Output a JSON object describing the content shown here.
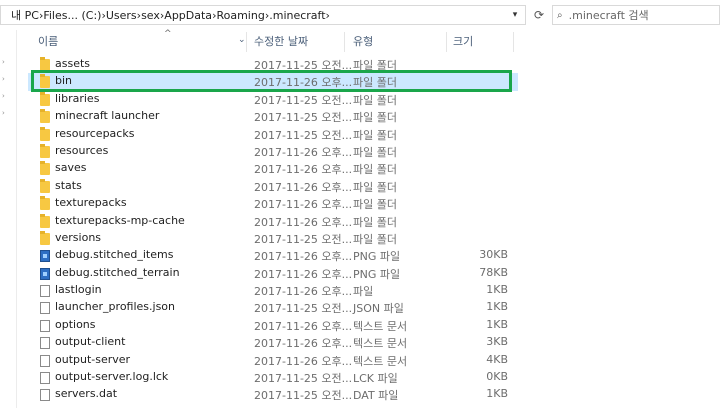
{
  "address": {
    "crumbs": [
      "내 PC",
      "Files... (C:)",
      "Users",
      "sex",
      "AppData",
      "Roaming",
      ".minecraft"
    ]
  },
  "search": {
    "placeholder": ".minecraft 검색"
  },
  "columns": {
    "name": "이름",
    "date": "수정한 날짜",
    "type": "유형",
    "size": "크기"
  },
  "files": [
    {
      "name": "assets",
      "date": "2017-11-25 오전...",
      "type": "파일 폴더",
      "size": "",
      "icon": "folder-icon"
    },
    {
      "name": "bin",
      "date": "2017-11-26 오후...",
      "type": "파일 폴더",
      "size": "",
      "icon": "folder-icon"
    },
    {
      "name": "libraries",
      "date": "2017-11-25 오전...",
      "type": "파일 폴더",
      "size": "",
      "icon": "folder-icon"
    },
    {
      "name": "minecraft launcher",
      "date": "2017-11-25 오전...",
      "type": "파일 폴더",
      "size": "",
      "icon": "folder-icon"
    },
    {
      "name": "resourcepacks",
      "date": "2017-11-25 오전...",
      "type": "파일 폴더",
      "size": "",
      "icon": "folder-icon"
    },
    {
      "name": "resources",
      "date": "2017-11-26 오후...",
      "type": "파일 폴더",
      "size": "",
      "icon": "folder-icon"
    },
    {
      "name": "saves",
      "date": "2017-11-26 오후...",
      "type": "파일 폴더",
      "size": "",
      "icon": "folder-icon"
    },
    {
      "name": "stats",
      "date": "2017-11-26 오후...",
      "type": "파일 폴더",
      "size": "",
      "icon": "folder-icon"
    },
    {
      "name": "texturepacks",
      "date": "2017-11-26 오후...",
      "type": "파일 폴더",
      "size": "",
      "icon": "folder-icon"
    },
    {
      "name": "texturepacks-mp-cache",
      "date": "2017-11-26 오후...",
      "type": "파일 폴더",
      "size": "",
      "icon": "folder-icon"
    },
    {
      "name": "versions",
      "date": "2017-11-25 오전...",
      "type": "파일 폴더",
      "size": "",
      "icon": "folder-icon"
    },
    {
      "name": "debug.stitched_items",
      "date": "2017-11-26 오후...",
      "type": "PNG 파일",
      "size": "30KB",
      "icon": "image-file-icon"
    },
    {
      "name": "debug.stitched_terrain",
      "date": "2017-11-26 오후...",
      "type": "PNG 파일",
      "size": "78KB",
      "icon": "image-file-icon"
    },
    {
      "name": "lastlogin",
      "date": "2017-11-26 오후...",
      "type": "파일",
      "size": "1KB",
      "icon": "file-icon"
    },
    {
      "name": "launcher_profiles.json",
      "date": "2017-11-25 오전...",
      "type": "JSON 파일",
      "size": "1KB",
      "icon": "file-icon"
    },
    {
      "name": "options",
      "date": "2017-11-26 오후...",
      "type": "텍스트 문서",
      "size": "1KB",
      "icon": "text-file-icon"
    },
    {
      "name": "output-client",
      "date": "2017-11-26 오후...",
      "type": "텍스트 문서",
      "size": "3KB",
      "icon": "text-file-icon"
    },
    {
      "name": "output-server",
      "date": "2017-11-26 오후...",
      "type": "텍스트 문서",
      "size": "4KB",
      "icon": "text-file-icon"
    },
    {
      "name": "output-server.log.lck",
      "date": "2017-11-25 오전...",
      "type": "LCK 파일",
      "size": "0KB",
      "icon": "file-icon"
    },
    {
      "name": "servers.dat",
      "date": "2017-11-25 오전...",
      "type": "DAT 파일",
      "size": "1KB",
      "icon": "file-icon"
    }
  ],
  "selected_index": 1,
  "colors": {
    "selection": "#cce8ff",
    "highlight_border": "#1aa64b",
    "folder": "#f7c842"
  }
}
